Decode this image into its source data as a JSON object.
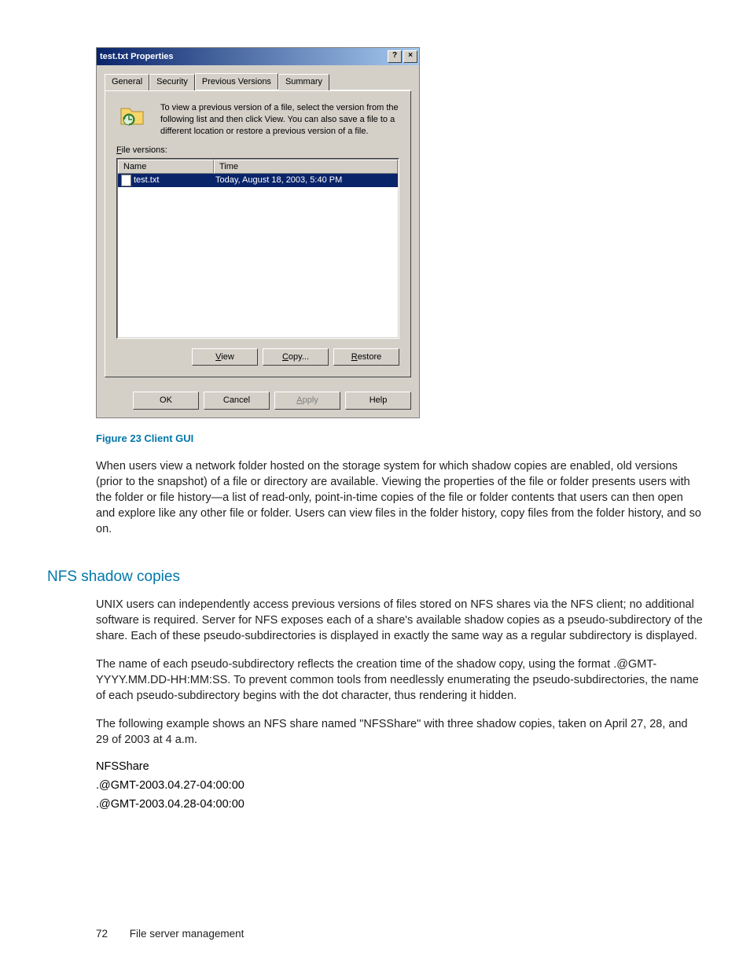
{
  "dialog": {
    "title": "test.txt Properties",
    "help_btn": "?",
    "close_btn": "×",
    "tabs": {
      "general": "General",
      "security": "Security",
      "previous": "Previous Versions",
      "summary": "Summary"
    },
    "intro": "To view a previous version of a file, select the version from the following list and then click View.  You can also save a file to a different location or restore a previous version of a file.",
    "file_versions_label": "File versions:",
    "columns": {
      "name": "Name",
      "time": "Time"
    },
    "rows": [
      {
        "name": "test.txt",
        "time": "Today, August 18, 2003, 5:40 PM"
      }
    ],
    "buttons": {
      "view": "View",
      "copy": "Copy...",
      "restore": "Restore"
    },
    "footer_buttons": {
      "ok": "OK",
      "cancel": "Cancel",
      "apply": "Apply",
      "help": "Help"
    }
  },
  "figure_caption": "Figure 23 Client GUI",
  "para1": "When users view a network folder hosted on the storage system for which shadow copies are enabled, old versions (prior to the snapshot) of a file or directory are available. Viewing the properties of the file or folder presents users with the folder or file history—a list of read-only, point-in-time copies of the file or folder contents that users can then open and explore like any other file or folder. Users can view files in the folder history, copy files from the folder history, and so on.",
  "section_title": "NFS shadow copies",
  "para2": "UNIX users can independently access previous versions of files stored on NFS shares via the NFS client; no additional software is required. Server for NFS exposes each of a share's available shadow copies as a pseudo-subdirectory of the share. Each of these pseudo-subdirectories is displayed in exactly the same way as a regular subdirectory is displayed.",
  "para3": "The name of each pseudo-subdirectory reflects the creation time of the shadow copy, using the format .@GMT-YYYY.MM.DD-HH:MM:SS. To prevent common tools from needlessly enumerating the pseudo-subdirectories, the name of each pseudo-subdirectory begins with the dot character, thus rendering it hidden.",
  "para4": "The following example shows an NFS share named \"NFSShare\" with three shadow copies, taken on April 27, 28, and 29 of 2003 at 4 a.m.",
  "example_lines": [
    "NFSShare",
    ".@GMT-2003.04.27-04:00:00",
    ".@GMT-2003.04.28-04:00:00"
  ],
  "footer": {
    "page": "72",
    "section": "File server management"
  }
}
